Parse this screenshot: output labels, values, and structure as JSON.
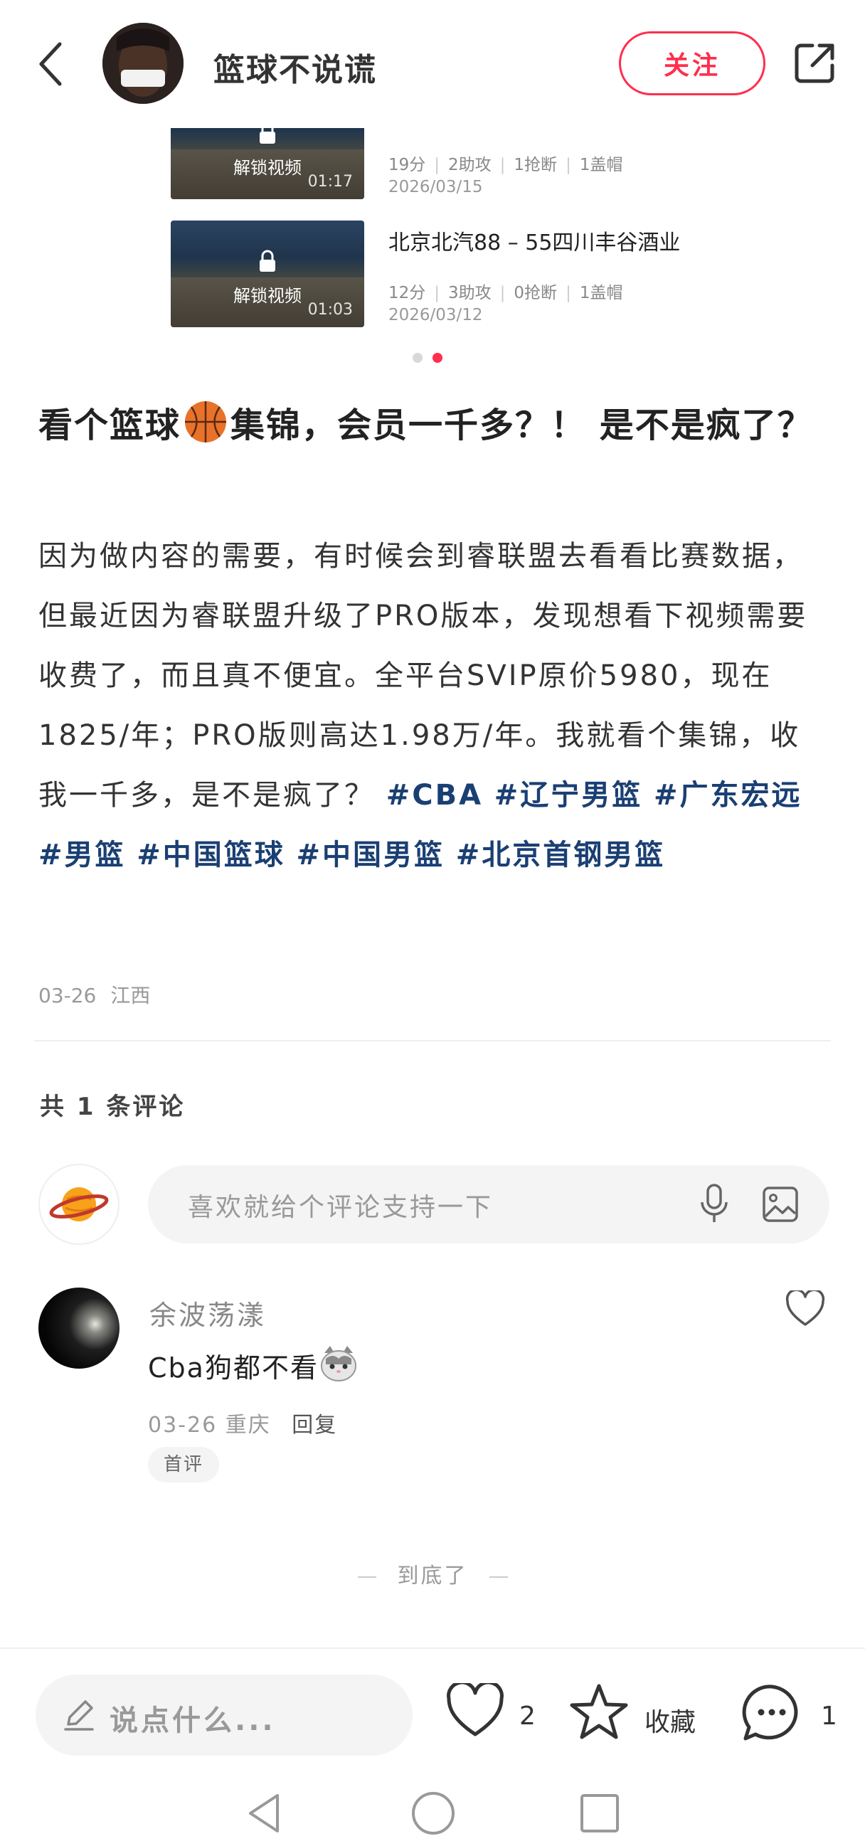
{
  "header": {
    "author_name": "篮球不说谎",
    "follow_label": "关注"
  },
  "videos": [
    {
      "title": "",
      "lock_label": "解锁视频",
      "duration": "01:17",
      "points": "19分",
      "assists": "2助攻",
      "steals": "1抢断",
      "blocks": "1盖帽",
      "date": "2026/03/15"
    },
    {
      "title": "北京北汽88 – 55四川丰谷酒业",
      "lock_label": "解锁视频",
      "duration": "01:03",
      "points": "12分",
      "assists": "3助攻",
      "steals": "0抢断",
      "blocks": "1盖帽",
      "date": "2026/03/12"
    }
  ],
  "carousel": {
    "count": 2,
    "active_index": 1
  },
  "post": {
    "title_part1": "看个篮球",
    "title_emoji": "basketball-emoji",
    "title_part2": "集锦，会员一千多？！ 是不是疯了？",
    "body": "因为做内容的需要，有时候会到睿联盟去看看比赛数据，但最近因为睿联盟升级了PRO版本，发现想看下视频需要收费了，而且真不便宜。全平台SVIP原价5980，现在1825/年；PRO版则高达1.98万/年。我就看个集锦，收我一千多，是不是疯了？",
    "tags": [
      "#CBA",
      "#辽宁男篮",
      "#广东宏远",
      "#男篮",
      "#中国篮球",
      "#中国男篮",
      "#北京首钢男篮"
    ],
    "date": "03-26",
    "location": "江西"
  },
  "comments_section": {
    "count_label": "共 1 条评论",
    "input_placeholder": "喜欢就给个评论支持一下"
  },
  "comments": [
    {
      "user": "余波荡漾",
      "text": "Cba狗都不看",
      "emoji": "cat-emoji",
      "date": "03-26",
      "location": "重庆",
      "reply_label": "回复",
      "badge": "首评"
    }
  ],
  "end_label": "到底了",
  "bottom_bar": {
    "say_placeholder": "说点什么...",
    "like_count": "2",
    "collect_label": "收藏",
    "comment_count": "1"
  },
  "colors": {
    "accent": "#ff2e4d",
    "tag": "#1a3f73",
    "muted": "#999999"
  }
}
